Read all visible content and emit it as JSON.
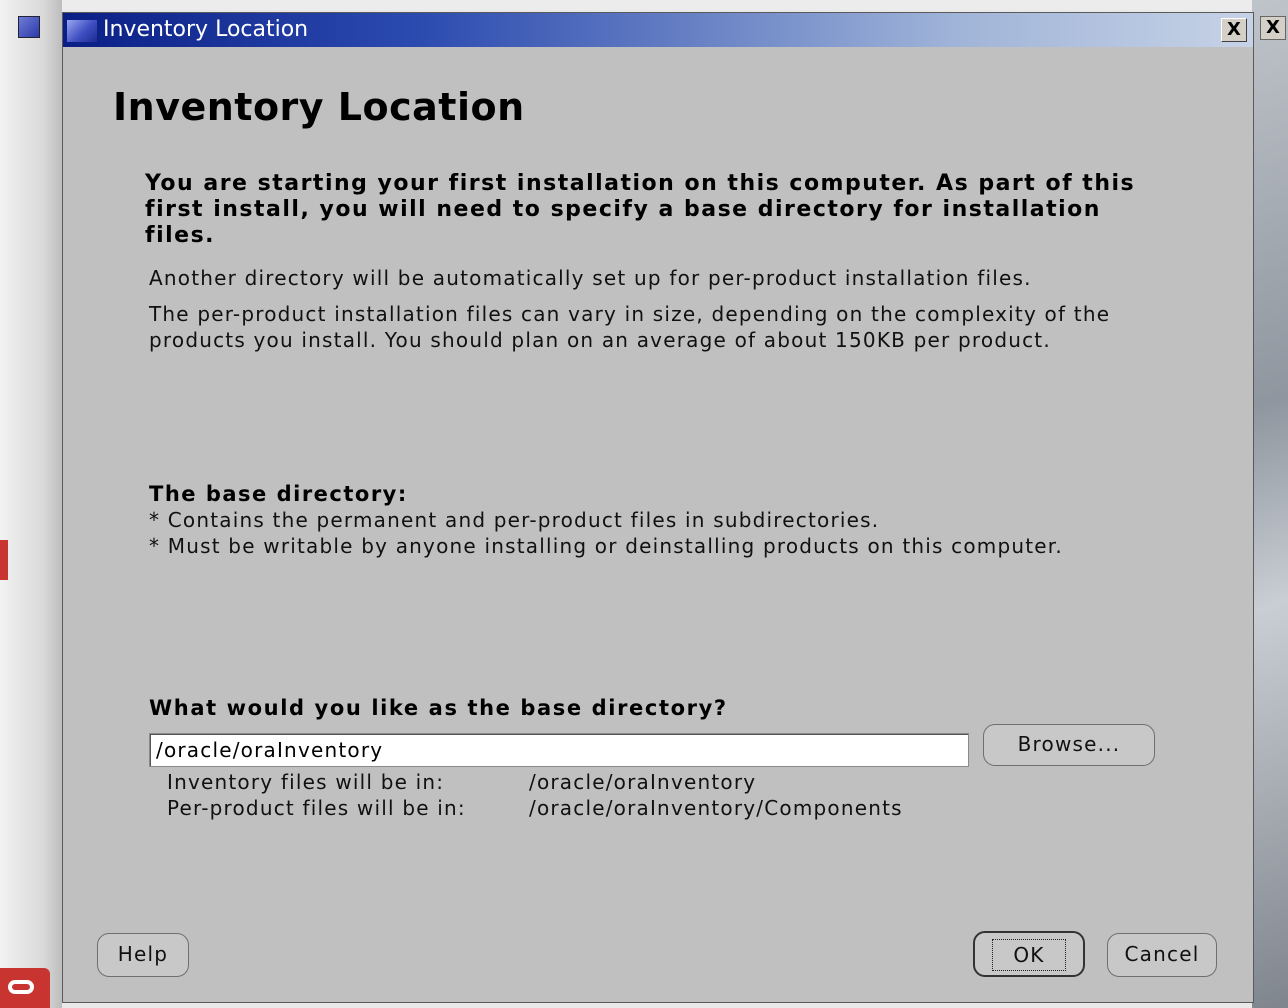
{
  "window": {
    "title": "Inventory Location",
    "close_glyph": "X"
  },
  "background": {
    "outer_close_glyph": "X"
  },
  "page": {
    "heading": "Inventory Location",
    "intro_bold": "You are starting your first installation on this computer. As part of this first install, you will need to specify a base directory for installation files.",
    "paragraph1": "Another directory will be automatically set up for per-product installation files.",
    "paragraph2": "The per-product installation files can vary in size, depending on the complexity of the products you install.  You should plan on an average of about 150KB per product.",
    "base_dir_heading": "The base directory:",
    "bullets": [
      "* Contains the permanent and per-product files in subdirectories.",
      "* Must be writable by anyone installing or deinstalling products on this computer."
    ],
    "question": "What would you like as the base directory?"
  },
  "directory": {
    "value": "/oracle/oraInventory",
    "browse_label": "Browse...",
    "inventory_files_label": "Inventory files will be in:",
    "inventory_files_value": "/oracle/oraInventory",
    "per_product_label": "Per-product files will be in:",
    "per_product_value": "/oracle/oraInventory/Components"
  },
  "buttons": {
    "help": "Help",
    "ok": "OK",
    "cancel": "Cancel"
  }
}
